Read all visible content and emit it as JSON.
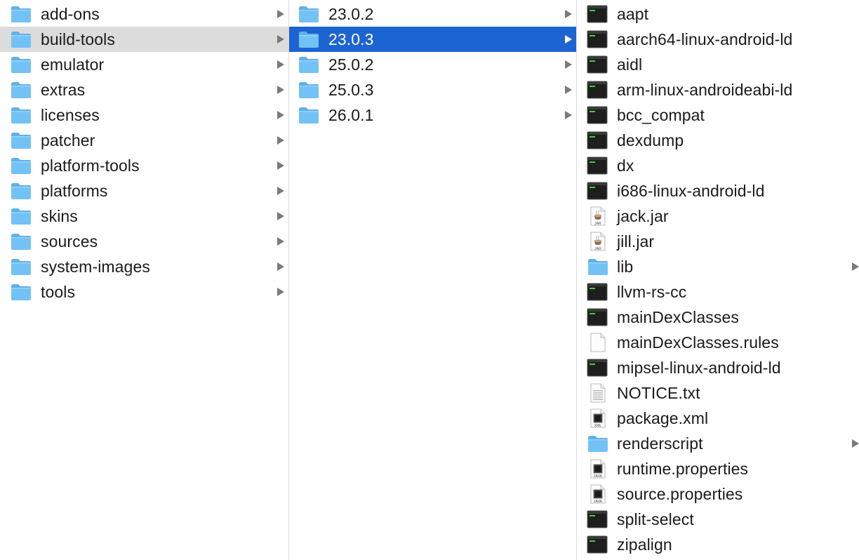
{
  "columns": [
    {
      "items": [
        {
          "name": "add-ons",
          "kind": "folder",
          "has_children": true,
          "state": "normal"
        },
        {
          "name": "build-tools",
          "kind": "folder",
          "has_children": true,
          "state": "active"
        },
        {
          "name": "emulator",
          "kind": "folder",
          "has_children": true,
          "state": "normal"
        },
        {
          "name": "extras",
          "kind": "folder",
          "has_children": true,
          "state": "normal"
        },
        {
          "name": "licenses",
          "kind": "folder",
          "has_children": true,
          "state": "normal"
        },
        {
          "name": "patcher",
          "kind": "folder",
          "has_children": true,
          "state": "normal"
        },
        {
          "name": "platform-tools",
          "kind": "folder",
          "has_children": true,
          "state": "normal"
        },
        {
          "name": "platforms",
          "kind": "folder",
          "has_children": true,
          "state": "normal"
        },
        {
          "name": "skins",
          "kind": "folder",
          "has_children": true,
          "state": "normal"
        },
        {
          "name": "sources",
          "kind": "folder",
          "has_children": true,
          "state": "normal"
        },
        {
          "name": "system-images",
          "kind": "folder",
          "has_children": true,
          "state": "normal"
        },
        {
          "name": "tools",
          "kind": "folder",
          "has_children": true,
          "state": "normal"
        }
      ]
    },
    {
      "items": [
        {
          "name": "23.0.2",
          "kind": "folder",
          "has_children": true,
          "state": "normal"
        },
        {
          "name": "23.0.3",
          "kind": "folder",
          "has_children": true,
          "state": "selected"
        },
        {
          "name": "25.0.2",
          "kind": "folder",
          "has_children": true,
          "state": "normal"
        },
        {
          "name": "25.0.3",
          "kind": "folder",
          "has_children": true,
          "state": "normal"
        },
        {
          "name": "26.0.1",
          "kind": "folder",
          "has_children": true,
          "state": "normal"
        }
      ]
    },
    {
      "items": [
        {
          "name": "aapt",
          "kind": "exec",
          "has_children": false,
          "state": "normal"
        },
        {
          "name": "aarch64-linux-android-ld",
          "kind": "exec",
          "has_children": false,
          "state": "normal"
        },
        {
          "name": "aidl",
          "kind": "exec",
          "has_children": false,
          "state": "normal"
        },
        {
          "name": "arm-linux-androideabi-ld",
          "kind": "exec",
          "has_children": false,
          "state": "normal"
        },
        {
          "name": "bcc_compat",
          "kind": "exec",
          "has_children": false,
          "state": "normal"
        },
        {
          "name": "dexdump",
          "kind": "exec",
          "has_children": false,
          "state": "normal"
        },
        {
          "name": "dx",
          "kind": "exec",
          "has_children": false,
          "state": "normal"
        },
        {
          "name": "i686-linux-android-ld",
          "kind": "exec",
          "has_children": false,
          "state": "normal"
        },
        {
          "name": "jack.jar",
          "kind": "jar",
          "badge": "JAR",
          "has_children": false,
          "state": "normal"
        },
        {
          "name": "jill.jar",
          "kind": "jar",
          "badge": "JAR",
          "has_children": false,
          "state": "normal"
        },
        {
          "name": "lib",
          "kind": "folder",
          "has_children": true,
          "state": "normal"
        },
        {
          "name": "llvm-rs-cc",
          "kind": "exec",
          "has_children": false,
          "state": "normal"
        },
        {
          "name": "mainDexClasses",
          "kind": "exec",
          "has_children": false,
          "state": "normal"
        },
        {
          "name": "mainDexClasses.rules",
          "kind": "blank",
          "has_children": false,
          "state": "normal"
        },
        {
          "name": "mipsel-linux-android-ld",
          "kind": "exec",
          "has_children": false,
          "state": "normal"
        },
        {
          "name": "NOTICE.txt",
          "kind": "text",
          "has_children": false,
          "state": "normal"
        },
        {
          "name": "package.xml",
          "kind": "doc",
          "badge": "XML",
          "has_children": false,
          "state": "normal"
        },
        {
          "name": "renderscript",
          "kind": "folder",
          "has_children": true,
          "state": "normal"
        },
        {
          "name": "runtime.properties",
          "kind": "doc",
          "badge": "JAVA",
          "has_children": false,
          "state": "normal"
        },
        {
          "name": "source.properties",
          "kind": "doc",
          "badge": "JAVA",
          "has_children": false,
          "state": "normal"
        },
        {
          "name": "split-select",
          "kind": "exec",
          "has_children": false,
          "state": "normal"
        },
        {
          "name": "zipalign",
          "kind": "exec",
          "has_children": false,
          "state": "normal"
        }
      ]
    }
  ],
  "colors": {
    "folder": "#72c2f6",
    "folder_tab": "#5fb1ea",
    "selection": "#1c64d2",
    "active_row": "#dcdcdc",
    "exec_green": "#38d238",
    "chevron": "#7a7a7a"
  }
}
